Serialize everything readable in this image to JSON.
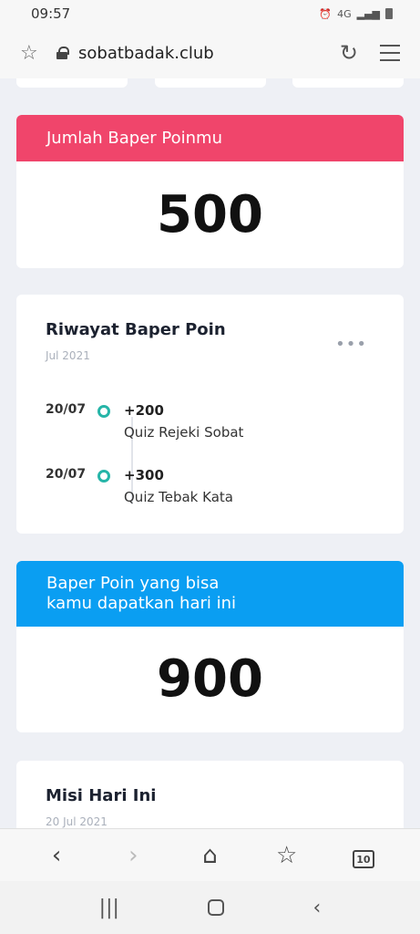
{
  "status": {
    "time": "09:57",
    "network": "4G"
  },
  "browser": {
    "url": "sobatbadak.club"
  },
  "points_card": {
    "title": "Jumlah Baper Poinmu",
    "value": "500",
    "color": "#f0456b"
  },
  "history": {
    "title": "Riwayat Baper Poin",
    "subtitle": "Jul 2021",
    "items": [
      {
        "date": "20/07",
        "points": "+200",
        "desc": "Quiz Rejeki Sobat"
      },
      {
        "date": "20/07",
        "points": "+300",
        "desc": "Quiz Tebak Kata"
      }
    ]
  },
  "today_card": {
    "title_line1": "Baper Poin yang bisa",
    "title_line2": "kamu dapatkan hari ini",
    "value": "900",
    "color": "#0a9ef2"
  },
  "mission": {
    "title": "Misi Hari Ini",
    "subtitle": "20 Jul 2021"
  },
  "nav": {
    "tabs_count": "10"
  }
}
